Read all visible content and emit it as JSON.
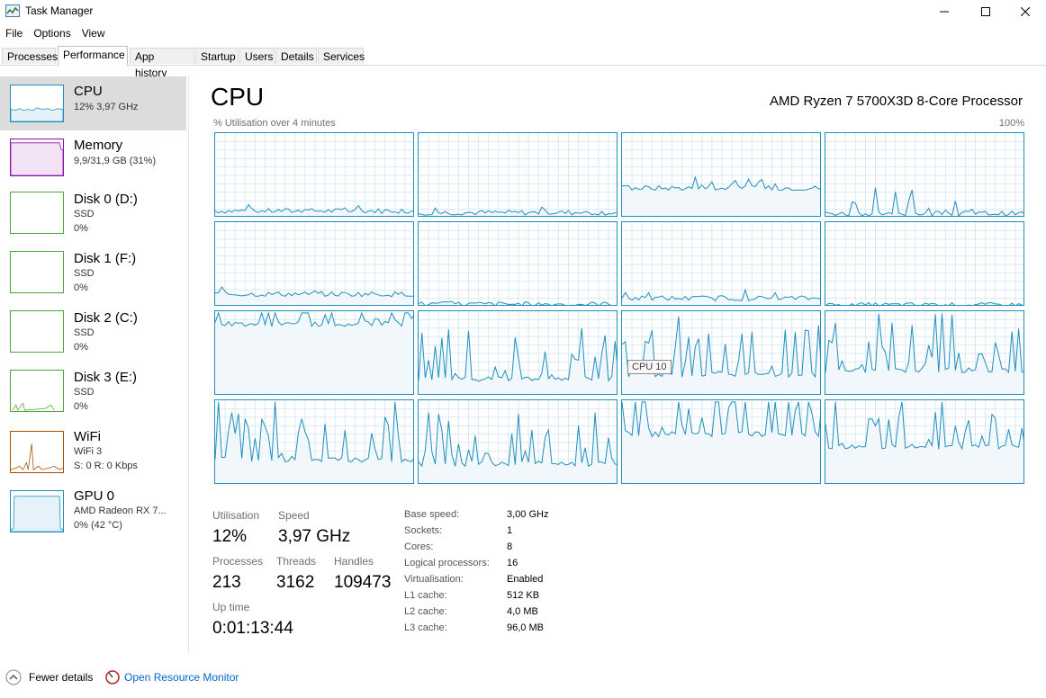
{
  "window": {
    "title": "Task Manager"
  },
  "menu": [
    "File",
    "Options",
    "View"
  ],
  "tabs": [
    "Processes",
    "Performance",
    "App history",
    "Startup",
    "Users",
    "Details",
    "Services"
  ],
  "sidebar": [
    {
      "name": "CPU",
      "line1": "12% 3,97 GHz",
      "line2": "",
      "color": "#1f8fbf"
    },
    {
      "name": "Memory",
      "line1": "9,9/31,9 GB (31%)",
      "line2": "",
      "color": "#8b12ae"
    },
    {
      "name": "Disk 0 (D:)",
      "line1": "SSD",
      "line2": "0%",
      "color": "#4ca83b"
    },
    {
      "name": "Disk 1 (F:)",
      "line1": "SSD",
      "line2": "0%",
      "color": "#4ca83b"
    },
    {
      "name": "Disk 2 (C:)",
      "line1": "SSD",
      "line2": "0%",
      "color": "#4ca83b"
    },
    {
      "name": "Disk 3 (E:)",
      "line1": "SSD",
      "line2": "0%",
      "color": "#4ca83b"
    },
    {
      "name": "WiFi",
      "line1": "WiFi 3",
      "line2": "S: 0 R: 0 Kbps",
      "color": "#a74f01"
    },
    {
      "name": "GPU 0",
      "line1": "AMD Radeon RX 7...",
      "line2": "0% (42 °C)",
      "color": "#1f8fbf"
    }
  ],
  "main": {
    "title": "CPU",
    "processor": "AMD Ryzen 7 5700X3D 8-Core Processor",
    "graph_label": "% Utilisation over 4 minutes",
    "graph_max": "100%",
    "tooltip": "CPU 10"
  },
  "stats": {
    "utilisation_label": "Utilisation",
    "utilisation": "12%",
    "speed_label": "Speed",
    "speed": "3,97 GHz",
    "processes_label": "Processes",
    "processes": "213",
    "threads_label": "Threads",
    "threads": "3162",
    "handles_label": "Handles",
    "handles": "109473",
    "uptime_label": "Up time",
    "uptime": "0:01:13:44"
  },
  "info": [
    {
      "k": "Base speed:",
      "v": "3,00 GHz"
    },
    {
      "k": "Sockets:",
      "v": "1"
    },
    {
      "k": "Cores:",
      "v": "8"
    },
    {
      "k": "Logical processors:",
      "v": "16"
    },
    {
      "k": "Virtualisation:",
      "v": "Enabled"
    },
    {
      "k": "L1 cache:",
      "v": "512 KB"
    },
    {
      "k": "L2 cache:",
      "v": "4,0 MB"
    },
    {
      "k": "L3 cache:",
      "v": "96,0 MB"
    }
  ],
  "footer": {
    "fewer": "Fewer details",
    "resmon": "Open Resource Monitor"
  }
}
